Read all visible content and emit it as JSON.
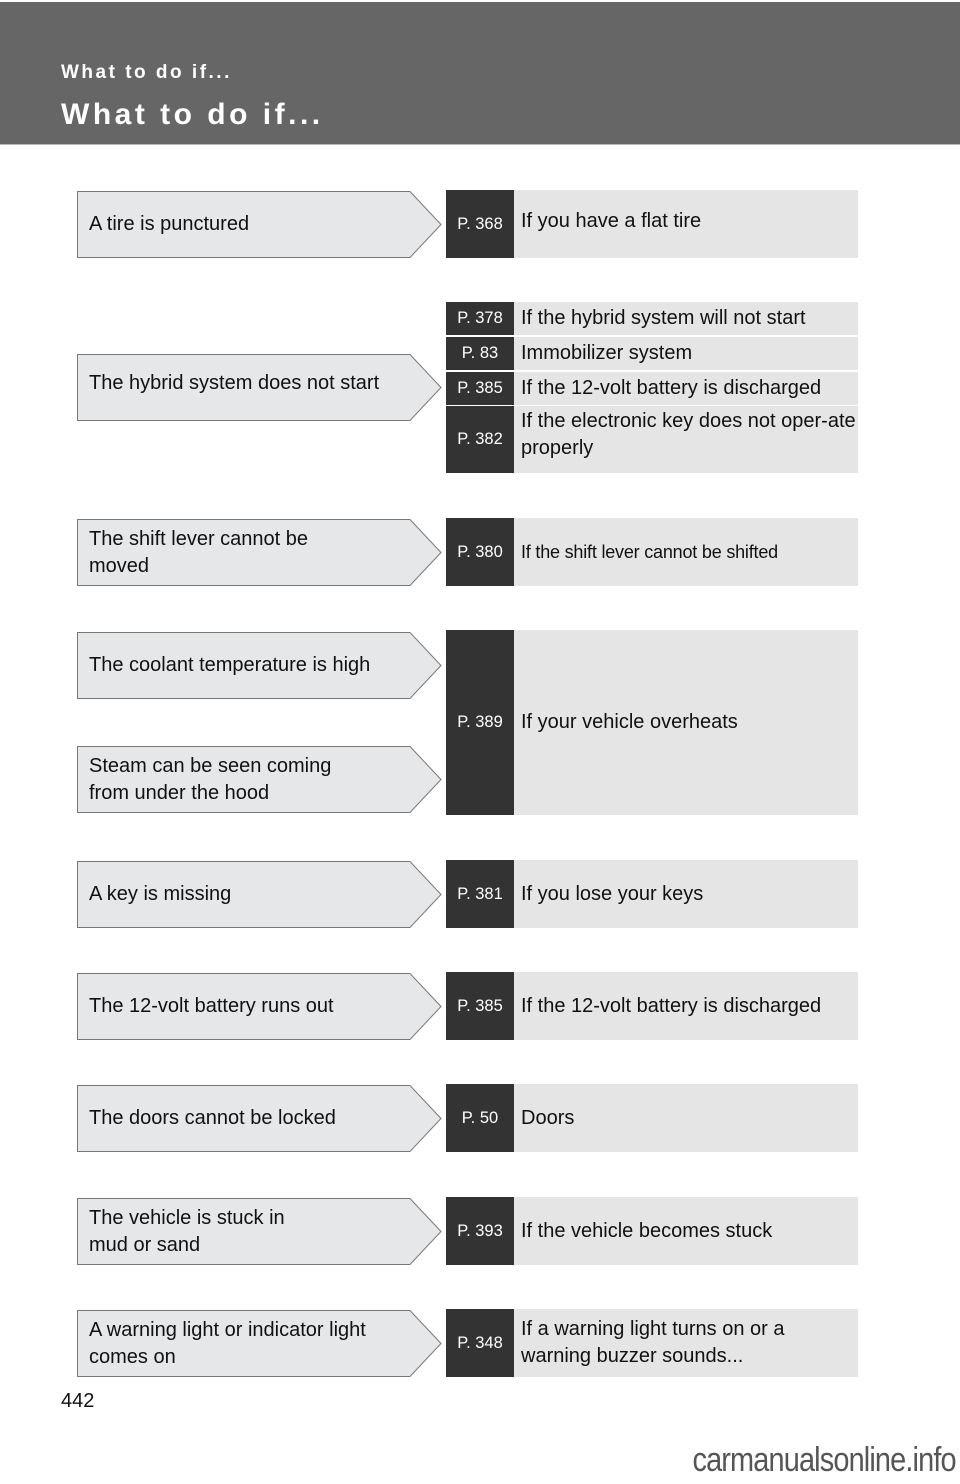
{
  "header": {
    "section_title": "What to do if...",
    "page_title": "What to do if..."
  },
  "rows": [
    {
      "conditions": [
        "A tire is punctured"
      ],
      "refs": [
        {
          "page": "P. 368",
          "text": "If you have a flat tire"
        }
      ]
    },
    {
      "conditions": [
        "The hybrid system does not start"
      ],
      "refs": [
        {
          "page": "P. 378",
          "text": "If the hybrid system will not start"
        },
        {
          "page": "P. 83",
          "text": "Immobilizer system"
        },
        {
          "page": "P. 385",
          "text": "If the 12-volt battery is discharged"
        },
        {
          "page": "P. 382",
          "text": "If the electronic key does not oper-ate properly"
        }
      ]
    },
    {
      "conditions": [
        "The shift lever cannot be moved"
      ],
      "refs": [
        {
          "page": "P. 380",
          "text": "If the shift lever cannot be shifted"
        }
      ]
    },
    {
      "conditions": [
        "The coolant temperature is high",
        "Steam can be seen coming from under the hood"
      ],
      "refs": [
        {
          "page": "P. 389",
          "text": "If your vehicle overheats"
        }
      ]
    },
    {
      "conditions": [
        "A key is missing"
      ],
      "refs": [
        {
          "page": "P. 381",
          "text": "If you lose your keys"
        }
      ]
    },
    {
      "conditions": [
        "The 12-volt battery runs out"
      ],
      "refs": [
        {
          "page": "P. 385",
          "text": "If the 12-volt battery is discharged"
        }
      ]
    },
    {
      "conditions": [
        "The doors cannot be locked"
      ],
      "refs": [
        {
          "page": "P. 50",
          "text": "Doors"
        }
      ]
    },
    {
      "conditions": [
        "The vehicle is stuck in mud or sand"
      ],
      "refs": [
        {
          "page": "P. 393",
          "text": "If the vehicle becomes stuck"
        }
      ]
    },
    {
      "conditions": [
        "A warning light or indicator light comes on"
      ],
      "refs": [
        {
          "page": "P. 348",
          "text": "If a warning light turns on or a warning buzzer sounds..."
        }
      ]
    }
  ],
  "footer": {
    "page_number": "442",
    "watermark": "carmanualsonline.info"
  }
}
